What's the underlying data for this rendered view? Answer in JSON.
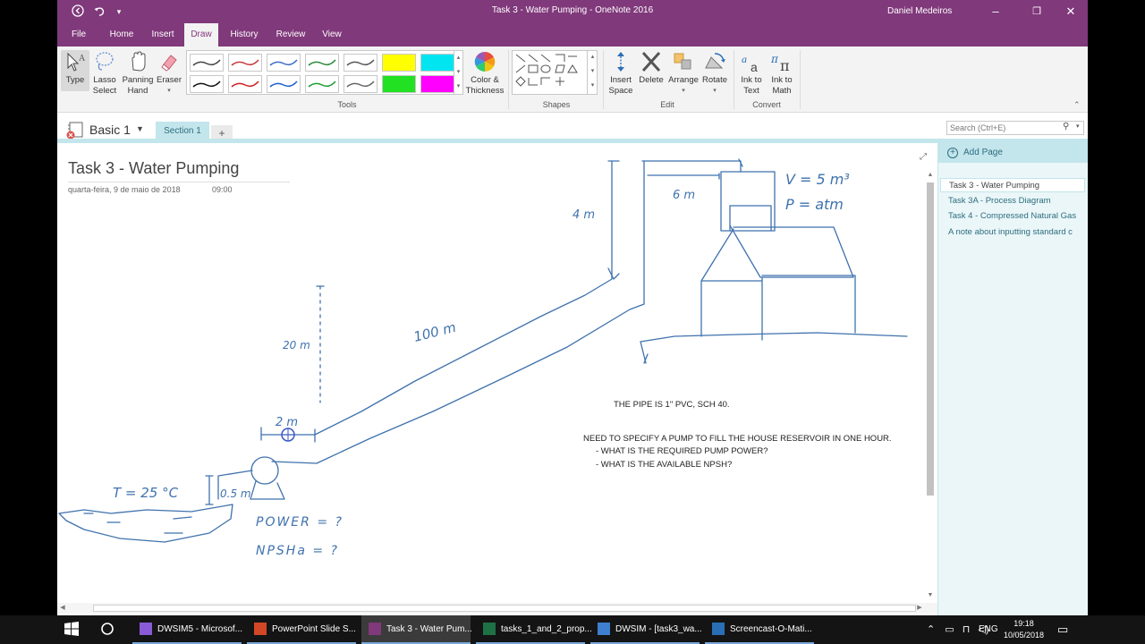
{
  "window": {
    "title": "Task 3 - Water Pumping  -  OneNote 2016",
    "user": "Daniel Medeiros",
    "back_icon": "back-circle-icon",
    "undo_icon": "undo-icon",
    "customize_icon": "customize-quick-access-icon",
    "minimize": "–",
    "restore": "❐",
    "close": "✕"
  },
  "tabs": [
    "File",
    "Home",
    "Insert",
    "Draw",
    "History",
    "Review",
    "View"
  ],
  "active_tab": "Draw",
  "ribbon": {
    "tools_buttons": [
      {
        "label": "Type"
      },
      {
        "label": "Lasso Select"
      },
      {
        "label": "Panning Hand"
      },
      {
        "label": "Eraser"
      }
    ],
    "color_thickness": "Color & Thickness",
    "group_tools": "Tools",
    "group_shapes": "Shapes",
    "edit_buttons": [
      {
        "label": "Insert Space"
      },
      {
        "label": "Delete"
      },
      {
        "label": "Arrange"
      },
      {
        "label": "Rotate"
      }
    ],
    "group_edit": "Edit",
    "convert_buttons": [
      {
        "label": "Ink to Text"
      },
      {
        "label": "Ink to Math"
      }
    ],
    "group_convert": "Convert",
    "pen_colors_top": [
      "#444444",
      "#c43b3b",
      "#3b6fc4",
      "#2a8a3a",
      "#555555",
      "#ffff00",
      "#00e5f0"
    ],
    "pen_colors_bottom": [
      "#111111",
      "#d01f1f",
      "#1f5fd0",
      "#1f9d2f",
      "#666666",
      "#22e022",
      "#ff00ff"
    ]
  },
  "notebook": {
    "name": "Basic 1",
    "section": "Section 1",
    "add_section": "+",
    "search_placeholder": "Search (Ctrl+E)"
  },
  "page": {
    "title": "Task 3 - Water Pumping",
    "date": "quarta-feira, 9 de maio de 2018",
    "time": "09:00",
    "notes": {
      "pipe": "THE PIPE IS 1\" PVC, SCH 40.",
      "need": "NEED TO SPECIFY A PUMP TO FILL THE HOUSE RESERVOIR IN ONE HOUR.",
      "q1": "-     WHAT IS THE REQUIRED PUMP POWER?",
      "q2": "-     WHAT IS THE AVAILABLE NPSH?"
    },
    "ink": {
      "v": "V = 5 m³",
      "p": "P = atm",
      "h4": "4 m",
      "w6": "6 m",
      "l100": "100 m",
      "h20": "20 m",
      "w2": "2 m",
      "t": "T = 25 °C",
      "h05": "0.5 m",
      "power": "POWER = ?",
      "npsh": "NPSHa = ?"
    }
  },
  "pages_pane": {
    "add_page": "Add Page",
    "items": [
      "Task 3 - Water Pumping",
      "Task 3A - Process Diagram",
      "Task 4 - Compressed Natural Gas",
      "A note about inputting standard c"
    ],
    "selected_index": 0
  },
  "taskbar": {
    "items": [
      {
        "label": "DWSIM5 - Microsof...",
        "icon": "visual-studio-icon",
        "color": "#8a5bd6"
      },
      {
        "label": "PowerPoint Slide S...",
        "icon": "powerpoint-icon",
        "color": "#d24726"
      },
      {
        "label": "Task 3 - Water Pum...",
        "icon": "onenote-icon",
        "color": "#80397b"
      },
      {
        "label": "tasks_1_and_2_prop...",
        "icon": "excel-icon",
        "color": "#1e7145"
      },
      {
        "label": "DWSIM - [task3_wa...",
        "icon": "dwsim-icon",
        "color": "#3f7fd0"
      },
      {
        "label": "Screencast-O-Mati...",
        "icon": "screencast-icon",
        "color": "#2a6fb5"
      }
    ],
    "lang": "ENG",
    "time": "19:18",
    "date": "10/05/2018"
  }
}
